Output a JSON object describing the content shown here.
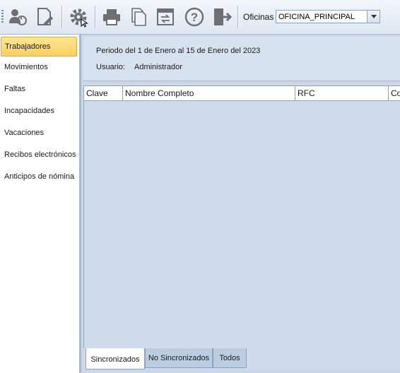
{
  "toolbar": {
    "buttons": [
      {
        "name": "user-sync-icon"
      },
      {
        "name": "edit-document-icon"
      },
      {
        "name": "gear-icon"
      },
      {
        "name": "printer-icon"
      },
      {
        "name": "copy-document-icon"
      },
      {
        "name": "transfer-window-icon"
      },
      {
        "name": "help-icon"
      },
      {
        "name": "exit-icon"
      }
    ],
    "oficinas_label": "Oficinas",
    "oficinas_value": "OFICINA_PRINCIPAL"
  },
  "sidebar": {
    "items": [
      {
        "label": "Trabajadores",
        "active": true
      },
      {
        "label": "Movimientos"
      },
      {
        "label": "Faltas"
      },
      {
        "label": "Incapacidades"
      },
      {
        "label": "Vacaciones"
      },
      {
        "label": "Recibos electrónicos"
      },
      {
        "label": "Anticipos de nómina"
      }
    ]
  },
  "info": {
    "period": "Periodo del 1 de Enero al 15 de Enero del 2023",
    "user_label": "Usuario:",
    "user_value": "Administrador"
  },
  "grid": {
    "columns": [
      "Clave",
      "Nombre Completo",
      "RFC",
      "Co"
    ]
  },
  "tabs": [
    "Sincronizados",
    "No Sincronizados",
    "Todos"
  ],
  "colors": {
    "active_item": "#ffd35f",
    "panel": "#d6e2f0",
    "border": "#8ea3bf"
  }
}
